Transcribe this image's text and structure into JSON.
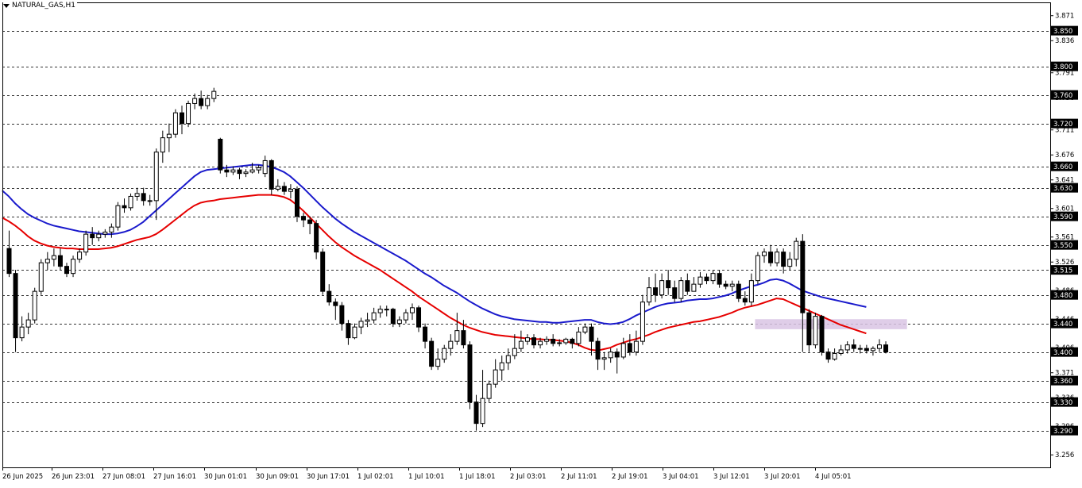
{
  "window": {
    "symbol_title": "NATURAL_GAS,H1"
  },
  "chart_data": {
    "type": "candlestick",
    "title": "NATURAL_GAS,H1",
    "timeframe": "H1",
    "ylim": [
      3.2385,
      3.8896
    ],
    "y_ticks": [
      "3.871",
      "3.836",
      "3.800",
      "3.791",
      "3.756",
      "3.720",
      "3.711",
      "3.676",
      "3.641",
      "3.630",
      "3.601",
      "3.590",
      "3.561",
      "3.550",
      "3.526",
      "3.515",
      "3.486",
      "3.480",
      "3.446",
      "3.440",
      "3.406",
      "3.400",
      "3.371",
      "3.360",
      "3.336",
      "3.330",
      "3.296",
      "3.290",
      "3.256"
    ],
    "x_ticks": [
      "26 Jun 2025",
      "26 Jun 23:01",
      "27 Jun 08:01",
      "27 Jun 16:01",
      "30 Jun 01:01",
      "30 Jun 09:01",
      "30 Jun 17:01",
      "1 Jul 02:01",
      "1 Jul 10:01",
      "1 Jul 18:01",
      "2 Jul 03:01",
      "2 Jul 11:01",
      "2 Jul 19:01",
      "3 Jul 04:01",
      "3 Jul 12:01",
      "3 Jul 20:01",
      "4 Jul 05:01"
    ],
    "levels": [
      {
        "label": "3.850",
        "value": 3.85
      },
      {
        "label": "3.800",
        "value": 3.8
      },
      {
        "label": "3.760",
        "value": 3.76
      },
      {
        "label": "3.720",
        "value": 3.72
      },
      {
        "label": "3.660",
        "value": 3.66
      },
      {
        "label": "3.630",
        "value": 3.63
      },
      {
        "label": "3.590",
        "value": 3.59
      },
      {
        "label": "3.550",
        "value": 3.55
      },
      {
        "label": "3.515",
        "value": 3.515
      },
      {
        "label": "3.480",
        "value": 3.48
      },
      {
        "label": "3.440",
        "value": 3.44
      },
      {
        "label": "3.400",
        "value": 3.4
      },
      {
        "label": "3.360",
        "value": 3.36
      },
      {
        "label": "3.330",
        "value": 3.33
      },
      {
        "label": "3.290",
        "value": 3.29
      }
    ],
    "zone": {
      "from_index": 117,
      "to_index": 140,
      "low": 3.432,
      "high": 3.446,
      "color": "#d9c4e4"
    },
    "series": [
      {
        "name": "",
        "color": "#1a1acc",
        "values": [
          3.626,
          3.618,
          3.608,
          3.6,
          3.593,
          3.588,
          3.584,
          3.58,
          3.577,
          3.575,
          3.573,
          3.571,
          3.569,
          3.568,
          3.567,
          3.566,
          3.565,
          3.565,
          3.566,
          3.568,
          3.571,
          3.576,
          3.582,
          3.59,
          3.598,
          3.606,
          3.614,
          3.622,
          3.63,
          3.638,
          3.646,
          3.652,
          3.655,
          3.656,
          3.657,
          3.658,
          3.659,
          3.66,
          3.661,
          3.662,
          3.662,
          3.661,
          3.659,
          3.656,
          3.652,
          3.646,
          3.638,
          3.63,
          3.621,
          3.612,
          3.603,
          3.595,
          3.587,
          3.58,
          3.574,
          3.568,
          3.563,
          3.558,
          3.553,
          3.548,
          3.543,
          3.538,
          3.533,
          3.528,
          3.522,
          3.516,
          3.51,
          3.505,
          3.499,
          3.493,
          3.488,
          3.483,
          3.477,
          3.471,
          3.466,
          3.461,
          3.457,
          3.453,
          3.45,
          3.448,
          3.446,
          3.445,
          3.444,
          3.443,
          3.442,
          3.442,
          3.441,
          3.441,
          3.442,
          3.443,
          3.444,
          3.445,
          3.445,
          3.442,
          3.44,
          3.439,
          3.44,
          3.442,
          3.446,
          3.451,
          3.455,
          3.459,
          3.463,
          3.466,
          3.468,
          3.469,
          3.47,
          3.472,
          3.473,
          3.474,
          3.474,
          3.475,
          3.477,
          3.479,
          3.482,
          3.486,
          3.489,
          3.492,
          3.494,
          3.497,
          3.501,
          3.502,
          3.5,
          3.496,
          3.491,
          3.486,
          3.483,
          3.48,
          3.477,
          3.475,
          3.473,
          3.471,
          3.469,
          3.467,
          3.465,
          3.463
        ]
      },
      {
        "name": "",
        "color": "#e60000",
        "values": [
          3.588,
          3.583,
          3.577,
          3.57,
          3.562,
          3.556,
          3.552,
          3.549,
          3.547,
          3.546,
          3.545,
          3.545,
          3.544,
          3.544,
          3.544,
          3.544,
          3.545,
          3.546,
          3.548,
          3.551,
          3.554,
          3.557,
          3.559,
          3.561,
          3.565,
          3.571,
          3.578,
          3.585,
          3.592,
          3.599,
          3.605,
          3.609,
          3.611,
          3.612,
          3.614,
          3.615,
          3.616,
          3.617,
          3.618,
          3.619,
          3.62,
          3.62,
          3.62,
          3.619,
          3.617,
          3.613,
          3.606,
          3.598,
          3.589,
          3.58,
          3.571,
          3.562,
          3.554,
          3.547,
          3.541,
          3.535,
          3.53,
          3.525,
          3.52,
          3.515,
          3.509,
          3.503,
          3.497,
          3.491,
          3.485,
          3.478,
          3.472,
          3.466,
          3.46,
          3.454,
          3.448,
          3.443,
          3.438,
          3.434,
          3.431,
          3.428,
          3.426,
          3.424,
          3.423,
          3.422,
          3.421,
          3.42,
          3.419,
          3.418,
          3.418,
          3.417,
          3.417,
          3.416,
          3.415,
          3.413,
          3.41,
          3.406,
          3.403,
          3.402,
          3.404,
          3.406,
          3.41,
          3.413,
          3.416,
          3.418,
          3.421,
          3.424,
          3.428,
          3.431,
          3.434,
          3.436,
          3.438,
          3.44,
          3.442,
          3.443,
          3.445,
          3.447,
          3.449,
          3.452,
          3.455,
          3.459,
          3.462,
          3.464,
          3.466,
          3.469,
          3.472,
          3.475,
          3.474,
          3.47,
          3.466,
          3.462,
          3.458,
          3.454,
          3.45,
          3.446,
          3.442,
          3.438,
          3.435,
          3.432,
          3.429,
          3.426
        ]
      }
    ],
    "candles": [
      [
        3.545,
        3.51,
        3.57,
        3.505
      ],
      [
        3.51,
        3.42,
        3.515,
        3.4
      ],
      [
        3.42,
        3.435,
        3.45,
        3.415
      ],
      [
        3.435,
        3.445,
        3.455,
        3.425
      ],
      [
        3.445,
        3.485,
        3.49,
        3.44
      ],
      [
        3.485,
        3.525,
        3.53,
        3.48
      ],
      [
        3.525,
        3.53,
        3.54,
        3.515
      ],
      [
        3.53,
        3.535,
        3.545,
        3.52
      ],
      [
        3.535,
        3.52,
        3.545,
        3.515
      ],
      [
        3.52,
        3.51,
        3.525,
        3.505
      ],
      [
        3.51,
        3.53,
        3.535,
        3.505
      ],
      [
        3.53,
        3.54,
        3.545,
        3.525
      ],
      [
        3.54,
        3.565,
        3.57,
        3.535
      ],
      [
        3.565,
        3.56,
        3.575,
        3.55
      ],
      [
        3.56,
        3.565,
        3.57,
        3.555
      ],
      [
        3.565,
        3.568,
        3.572,
        3.56
      ],
      [
        3.568,
        3.575,
        3.58,
        3.56
      ],
      [
        3.575,
        3.605,
        3.61,
        3.57
      ],
      [
        3.605,
        3.602,
        3.615,
        3.595
      ],
      [
        3.602,
        3.618,
        3.622,
        3.598
      ],
      [
        3.618,
        3.622,
        3.63,
        3.612
      ],
      [
        3.622,
        3.612,
        3.63,
        3.605
      ],
      [
        3.612,
        3.612,
        3.62,
        3.605
      ],
      [
        3.612,
        3.68,
        3.685,
        3.585
      ],
      [
        3.68,
        3.7,
        3.71,
        3.665
      ],
      [
        3.7,
        3.705,
        3.72,
        3.68
      ],
      [
        3.705,
        3.735,
        3.74,
        3.7
      ],
      [
        3.735,
        3.72,
        3.745,
        3.705
      ],
      [
        3.72,
        3.748,
        3.752,
        3.715
      ],
      [
        3.748,
        3.755,
        3.762,
        3.74
      ],
      [
        3.755,
        3.745,
        3.766,
        3.74
      ],
      [
        3.745,
        3.755,
        3.76,
        3.74
      ],
      [
        3.755,
        3.765,
        3.77,
        3.75
      ],
      [
        3.698,
        3.655,
        3.7,
        3.65
      ],
      [
        3.655,
        3.652,
        3.662,
        3.645
      ],
      [
        3.652,
        3.655,
        3.66,
        3.648
      ],
      [
        3.655,
        3.65,
        3.658,
        3.642
      ],
      [
        3.65,
        3.652,
        3.656,
        3.645
      ],
      [
        3.652,
        3.655,
        3.665,
        3.65
      ],
      [
        3.655,
        3.658,
        3.662,
        3.65
      ],
      [
        3.65,
        3.668,
        3.675,
        3.645
      ],
      [
        3.668,
        3.628,
        3.67,
        3.62
      ],
      [
        3.628,
        3.632,
        3.642,
        3.625
      ],
      [
        3.632,
        3.625,
        3.638,
        3.62
      ],
      [
        3.625,
        3.628,
        3.635,
        3.615
      ],
      [
        3.628,
        3.59,
        3.632,
        3.582
      ],
      [
        3.59,
        3.585,
        3.595,
        3.575
      ],
      [
        3.585,
        3.58,
        3.59,
        3.565
      ],
      [
        3.58,
        3.54,
        3.585,
        3.53
      ],
      [
        3.54,
        3.485,
        3.545,
        3.48
      ],
      [
        3.485,
        3.47,
        3.495,
        3.465
      ],
      [
        3.47,
        3.465,
        3.475,
        3.445
      ],
      [
        3.465,
        3.44,
        3.47,
        3.43
      ],
      [
        3.44,
        3.42,
        3.445,
        3.41
      ],
      [
        3.42,
        3.435,
        3.44,
        3.418
      ],
      [
        3.435,
        3.443,
        3.448,
        3.425
      ],
      [
        3.443,
        3.445,
        3.455,
        3.435
      ],
      [
        3.445,
        3.455,
        3.462,
        3.44
      ],
      [
        3.455,
        3.46,
        3.465,
        3.448
      ],
      [
        3.46,
        3.46,
        3.465,
        3.45
      ],
      [
        3.46,
        3.44,
        3.462,
        3.435
      ],
      [
        3.44,
        3.445,
        3.45,
        3.435
      ],
      [
        3.445,
        3.455,
        3.46,
        3.44
      ],
      [
        3.455,
        3.462,
        3.468,
        3.445
      ],
      [
        3.462,
        3.435,
        3.465,
        3.428
      ],
      [
        3.435,
        3.415,
        3.44,
        3.405
      ],
      [
        3.415,
        3.38,
        3.42,
        3.375
      ],
      [
        3.38,
        3.39,
        3.405,
        3.375
      ],
      [
        3.39,
        3.405,
        3.41,
        3.385
      ],
      [
        3.405,
        3.415,
        3.425,
        3.395
      ],
      [
        3.415,
        3.43,
        3.455,
        3.41
      ],
      [
        3.43,
        3.41,
        3.445,
        3.405
      ],
      [
        3.41,
        3.33,
        3.415,
        3.32
      ],
      [
        3.33,
        3.3,
        3.34,
        3.29
      ],
      [
        3.3,
        3.335,
        3.375,
        3.295
      ],
      [
        3.335,
        3.355,
        3.36,
        3.33
      ],
      [
        3.355,
        3.375,
        3.39,
        3.35
      ],
      [
        3.375,
        3.385,
        3.395,
        3.36
      ],
      [
        3.385,
        3.395,
        3.405,
        3.375
      ],
      [
        3.395,
        3.405,
        3.425,
        3.39
      ],
      [
        3.405,
        3.415,
        3.43,
        3.4
      ],
      [
        3.415,
        3.42,
        3.425,
        3.41
      ],
      [
        3.42,
        3.41,
        3.425,
        3.405
      ],
      [
        3.41,
        3.415,
        3.42,
        3.405
      ],
      [
        3.415,
        3.418,
        3.422,
        3.41
      ],
      [
        3.418,
        3.412,
        3.425,
        3.408
      ],
      [
        3.412,
        3.413,
        3.418,
        3.408
      ],
      [
        3.413,
        3.418,
        3.42,
        3.41
      ],
      [
        3.418,
        3.412,
        3.42,
        3.405
      ],
      [
        3.412,
        3.428,
        3.435,
        3.408
      ],
      [
        3.428,
        3.435,
        3.44,
        3.425
      ],
      [
        3.435,
        3.415,
        3.44,
        3.395
      ],
      [
        3.415,
        3.39,
        3.42,
        3.375
      ],
      [
        3.39,
        3.392,
        3.4,
        3.375
      ],
      [
        3.392,
        3.4,
        3.405,
        3.385
      ],
      [
        3.4,
        3.393,
        3.405,
        3.37
      ],
      [
        3.393,
        3.412,
        3.42,
        3.39
      ],
      [
        3.412,
        3.4,
        3.425,
        3.395
      ],
      [
        3.4,
        3.415,
        3.43,
        3.395
      ],
      [
        3.415,
        3.47,
        3.48,
        3.41
      ],
      [
        3.47,
        3.49,
        3.505,
        3.465
      ],
      [
        3.49,
        3.48,
        3.51,
        3.47
      ],
      [
        3.48,
        3.5,
        3.51,
        3.475
      ],
      [
        3.5,
        3.49,
        3.515,
        3.48
      ],
      [
        3.49,
        3.475,
        3.5,
        3.47
      ],
      [
        3.475,
        3.5,
        3.505,
        3.47
      ],
      [
        3.5,
        3.485,
        3.51,
        3.48
      ],
      [
        3.485,
        3.495,
        3.505,
        3.485
      ],
      [
        3.495,
        3.505,
        3.512,
        3.49
      ],
      [
        3.505,
        3.5,
        3.51,
        3.495
      ],
      [
        3.5,
        3.51,
        3.515,
        3.495
      ],
      [
        3.51,
        3.495,
        3.515,
        3.49
      ],
      [
        3.495,
        3.492,
        3.5,
        3.488
      ],
      [
        3.492,
        3.495,
        3.5,
        3.485
      ],
      [
        3.495,
        3.475,
        3.5,
        3.47
      ],
      [
        3.475,
        3.47,
        3.485,
        3.465
      ],
      [
        3.47,
        3.5,
        3.51,
        3.465
      ],
      [
        3.5,
        3.535,
        3.54,
        3.495
      ],
      [
        3.535,
        3.54,
        3.545,
        3.525
      ],
      [
        3.54,
        3.525,
        3.55,
        3.52
      ],
      [
        3.525,
        3.54,
        3.545,
        3.52
      ],
      [
        3.54,
        3.52,
        3.545,
        3.51
      ],
      [
        3.52,
        3.53,
        3.54,
        3.515
      ],
      [
        3.53,
        3.555,
        3.56,
        3.52
      ],
      [
        3.555,
        3.455,
        3.565,
        3.4
      ],
      [
        3.455,
        3.41,
        3.46,
        3.4
      ],
      [
        3.41,
        3.45,
        3.455,
        3.405
      ],
      [
        3.45,
        3.4,
        3.452,
        3.395
      ],
      [
        3.4,
        3.39,
        3.405,
        3.385
      ],
      [
        3.39,
        3.398,
        3.405,
        3.388
      ],
      [
        3.398,
        3.403,
        3.41,
        3.395
      ],
      [
        3.403,
        3.41,
        3.415,
        3.398
      ],
      [
        3.41,
        3.405,
        3.418,
        3.4
      ],
      [
        3.405,
        3.405,
        3.41,
        3.398
      ],
      [
        3.405,
        3.402,
        3.41,
        3.398
      ],
      [
        3.402,
        3.405,
        3.408,
        3.395
      ],
      [
        3.405,
        3.41,
        3.418,
        3.4
      ],
      [
        3.41,
        3.4,
        3.415,
        3.398
      ]
    ]
  }
}
